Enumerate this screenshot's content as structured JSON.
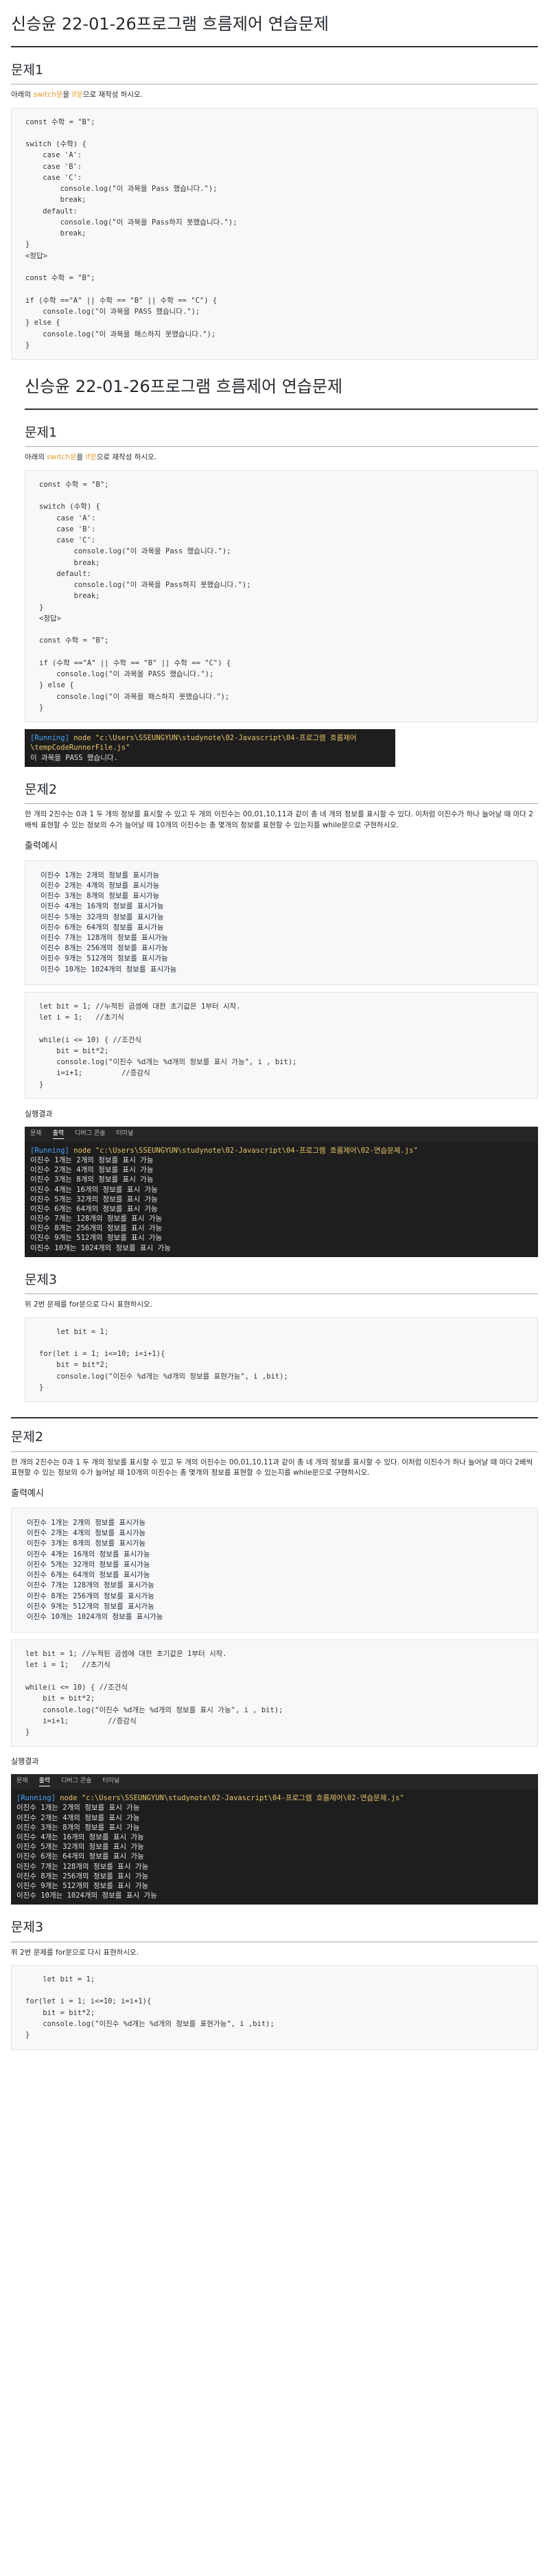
{
  "title": "신승윤 22-01-26프로그램 흐름제어 연습문제",
  "p1": {
    "heading": "문제1",
    "desc_pre": "아래의 ",
    "desc_hl1": "switch문",
    "desc_mid": "을 ",
    "desc_hl2": "if문",
    "desc_post": "으로 재작성 하시오.",
    "code": [
      "const 수학 = \"B\";",
      "",
      "switch (수학) {",
      "    case 'A':",
      "    case 'B':",
      "    case 'C':",
      "        console.log(\"이 과목을 Pass 했습니다.\");",
      "        break;",
      "    default:",
      "        console.log(\"이 과목을 Pass하지 못했습니다.\");",
      "        break;",
      "}",
      "<정답>",
      "",
      "const 수학 = \"B\";",
      "",
      "if (수학 ==\"A\" || 수학 == \"B\" || 수학 == \"C\") {",
      "    console.log(\"이 과목을 PASS 했습니다.\");",
      "} else {",
      "    console.log(\"이 과목을 패스하지 못했습니다.\");",
      "}"
    ]
  },
  "run1": {
    "running": "[Running]",
    "cmd": " node \"c:\\Users\\SSEUNGYUN\\studynote\\02-Javascript\\04-프로그램 흐름제어\\tempCodeRunnerFile.js\"",
    "output": "이 과목을 PASS 했습니다."
  },
  "p2": {
    "heading": "문제2",
    "desc": "한 개의 2진수는 0과 1 두 개의 정보를 표시할 수 있고 두 개의 이진수는 00,01,10,11과 같이 총 네 개의 정보를 표시할 수 있다. 이처럼 이진수가 하나 늘어날 때 마다 2배씩 표현할 수 있는 정보의 수가 늘어날 때 10개의 이진수는 총 몇개의 정보를 표현할 수 있는지를 while문으로 구현하시오.",
    "desc_hl": "00,01,10,11",
    "example_heading": "출력예시",
    "example_lines": [
      "이진수 1개는 2개의 정보를 표시가능",
      "이진수 2개는 4개의 정보를 표시가능",
      "이진수 3개는 8개의 정보를 표시가능",
      "이진수 4개는 16개의 정보를 표시가능",
      "이진수 5개는 32개의 정보를 표시가능",
      "이진수 6개는 64개의 정보를 표시가능",
      "이진수 7개는 128개의 정보를 표시가능",
      "이진수 8개는 256개의 정보를 표시가능",
      "이진수 9개는 512개의 정보를 표시가능",
      "이진수 10개는 1024개의 정보를 표시가능"
    ],
    "code": [
      "let bit = 1; //누적된 곱셈에 대한 초기값은 1부터 시작.",
      "let i = 1;   //초기식",
      "",
      "while(i <= 10) { //조건식",
      "    bit = bit*2;",
      "    console.log(\"이진수 %d개는 %d개의 정보를 표시 가능\", i , bit);",
      "    i=i+1;         //증감식",
      "}"
    ],
    "result_heading": "실행결과",
    "term_tabs": [
      "문제",
      "출력",
      "디버그 콘솔",
      "터미널"
    ],
    "run_label": "[Running]",
    "run_cmd": " node \"c:\\Users\\SSEUNGYUN\\studynote\\02-Javascript\\04-프로그램 흐름제어\\02-연습문제.js\"",
    "result_lines": [
      "이진수 1개는 2개의 정보를 표시 가능",
      "이진수 2개는 4개의 정보를 표시 가능",
      "이진수 3개는 8개의 정보를 표시 가능",
      "이진수 4개는 16개의 정보를 표시 가능",
      "이진수 5개는 32개의 정보를 표시 가능",
      "이진수 6개는 64개의 정보를 표시 가능",
      "이진수 7개는 128개의 정보를 표시 가능",
      "이진수 8개는 256개의 정보를 표시 가능",
      "이진수 9개는 512개의 정보를 표시 가능",
      "이진수 10개는 1024개의 정보를 표시 가능"
    ]
  },
  "p3": {
    "heading": "문제3",
    "desc": "위 2번 문제를 for문으로 다시 표현하시오.",
    "code": [
      "    let bit = 1;",
      "",
      "for(let i = 1; i<=10; i=i+1){",
      "    bit = bit*2;",
      "    console.log(\"이진수 %d개는 %d개의 정보를 표현가능\", i ,bit);",
      "}"
    ]
  }
}
